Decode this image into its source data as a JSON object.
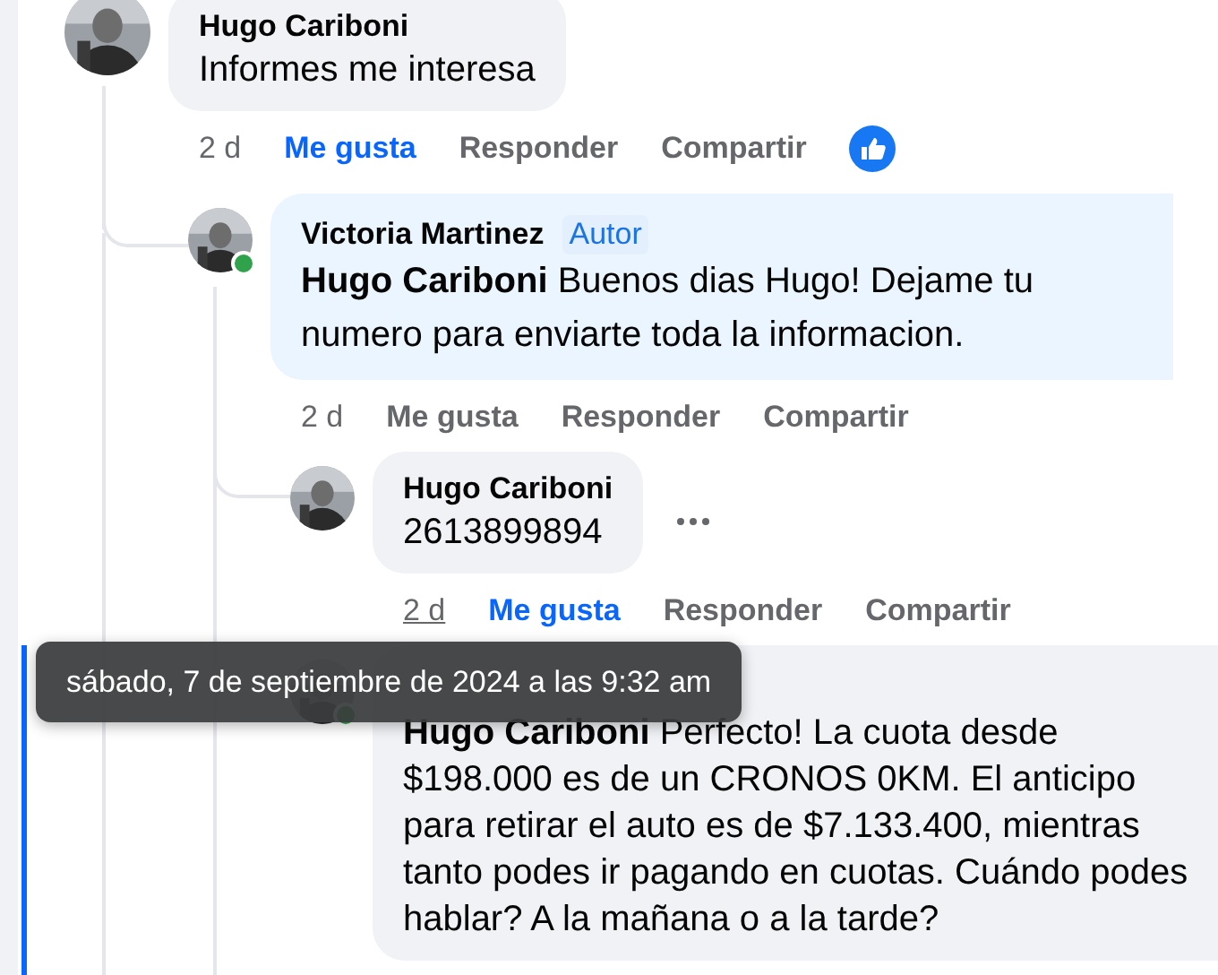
{
  "comments": [
    {
      "author": "Hugo Cariboni",
      "text": "Informes me interesa",
      "time": "2 d",
      "time_hovered": false,
      "liked": true,
      "reaction": {
        "kind": "like"
      },
      "actions": {
        "like": "Me gusta",
        "reply": "Responder",
        "share": "Compartir"
      },
      "children": [
        {
          "author": "Victoria Martinez",
          "badge": "Autor",
          "text": "**Hugo Cariboni** Buenos dias Hugo! Dejame tu numero para enviarte toda la informacion.",
          "online": true,
          "time": "2 d",
          "time_hovered": false,
          "liked": false,
          "actions": {
            "like": "Me gusta",
            "reply": "Responder",
            "share": "Compartir"
          },
          "children": [
            {
              "author": "Hugo Cariboni",
              "text": "2613899894",
              "more_menu": true,
              "time": "2 d",
              "time_hovered": true,
              "liked": true,
              "actions": {
                "like": "Me gusta",
                "reply": "Responder",
                "share": "Compartir"
              }
            },
            {
              "text": "**Hugo Cariboni** Perfecto! La cuota desde $198.000 es de un CRONOS 0KM. El anticipo para retirar el auto es de $7.133.400, mientras tanto podes ir pagando en cuotas. Cuándo podes hablar? A la mañana o a la tarde?",
              "online": true,
              "highlighted": true
            }
          ]
        }
      ]
    }
  ],
  "tooltip": {
    "text": "sábado, 7 de septiembre de 2024 a las 9:32 am"
  }
}
